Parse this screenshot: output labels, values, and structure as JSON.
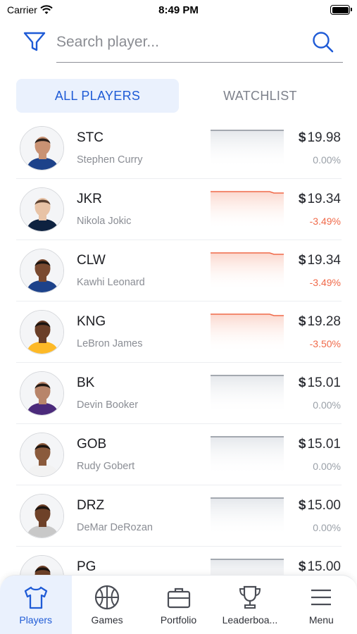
{
  "status_bar": {
    "carrier": "Carrier",
    "time": "8:49 PM"
  },
  "search": {
    "placeholder": "Search player..."
  },
  "tabs": [
    {
      "label": "ALL PLAYERS",
      "active": true
    },
    {
      "label": "WATCHLIST",
      "active": false
    }
  ],
  "players": [
    {
      "ticker": "STC",
      "name": "Stephen Curry",
      "price": "19.98",
      "change": "0.00%",
      "trend": "neutral",
      "jersey": "#1d428a",
      "skin": "#c99273",
      "hair": "#2a1f1a"
    },
    {
      "ticker": "JKR",
      "name": "Nikola Jokic",
      "price": "19.34",
      "change": "-3.49%",
      "trend": "negative",
      "jersey": "#0e2240",
      "skin": "#e8c3a6",
      "hair": "#5a4030"
    },
    {
      "ticker": "CLW",
      "name": "Kawhi Leonard",
      "price": "19.34",
      "change": "-3.49%",
      "trend": "negative",
      "jersey": "#1d428a",
      "skin": "#7a4a30",
      "hair": "#1b1410"
    },
    {
      "ticker": "KNG",
      "name": "LeBron James",
      "price": "19.28",
      "change": "-3.50%",
      "trend": "negative",
      "jersey": "#fdb927",
      "skin": "#6b3f28",
      "hair": "#1b1410"
    },
    {
      "ticker": "BK",
      "name": "Devin Booker",
      "price": "15.01",
      "change": "0.00%",
      "trend": "neutral",
      "jersey": "#4b2a7b",
      "skin": "#b8856a",
      "hair": "#1f1712"
    },
    {
      "ticker": "GOB",
      "name": "Rudy Gobert",
      "price": "15.01",
      "change": "0.00%",
      "trend": "neutral",
      "jersey": "#f2f2f2",
      "skin": "#8a5a3c",
      "hair": "#1b1410"
    },
    {
      "ticker": "DRZ",
      "name": "DeMar DeRozan",
      "price": "15.00",
      "change": "0.00%",
      "trend": "neutral",
      "jersey": "#c8c8c8",
      "skin": "#6e4128",
      "hair": "#1b1410"
    },
    {
      "ticker": "PG",
      "name": "",
      "price": "15.00",
      "change": "",
      "trend": "neutral",
      "jersey": "#c8102e",
      "skin": "#6e4128",
      "hair": "#1b1410"
    }
  ],
  "currency_symbol": "$",
  "colors": {
    "accent": "#1f5bd6",
    "negative": "#f06a4a",
    "neutral": "#9aa0a8"
  },
  "nav": [
    {
      "label": "Players",
      "icon": "tshirt-icon",
      "active": true
    },
    {
      "label": "Games",
      "icon": "basketball-icon",
      "active": false
    },
    {
      "label": "Portfolio",
      "icon": "briefcase-icon",
      "active": false
    },
    {
      "label": "Leaderboa...",
      "icon": "trophy-icon",
      "active": false
    },
    {
      "label": "Menu",
      "icon": "menu-icon",
      "active": false
    }
  ]
}
